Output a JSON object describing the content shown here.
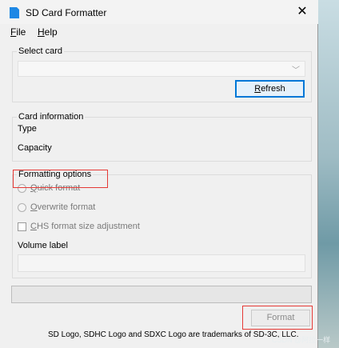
{
  "window": {
    "title": "SD Card Formatter",
    "close_glyph": "✕",
    "app_icon": "sd-card-icon"
  },
  "menu": [
    {
      "accel": "F",
      "rest": "ile"
    },
    {
      "accel": "H",
      "rest": "elp"
    }
  ],
  "select_card": {
    "group_label": "Select card",
    "selected": "",
    "refresh": {
      "accel": "R",
      "rest": "efresh"
    }
  },
  "card_info": {
    "group_label": "Card information",
    "type_label": "Type",
    "capacity_label": "Capacity"
  },
  "formatting_options": {
    "group_label": "Formatting options",
    "quick_format": {
      "accel": "Q",
      "rest": "uick format"
    },
    "overwrite_format": {
      "accel": "O",
      "rest": "verwrite format"
    },
    "chs": {
      "accel": "C",
      "rest": "HS format size adjustment"
    },
    "volume_label": "Volume label",
    "volume_value": ""
  },
  "progress_percent": 0,
  "format_button": "Format",
  "trademark": "SD Logo, SDHC Logo and SDXC Logo are trademarks of SD-3C, LLC.",
  "watermark": "CSDN @阿拉一样",
  "colors": {
    "accent": "#0078d7",
    "highlight": "#e53935"
  }
}
